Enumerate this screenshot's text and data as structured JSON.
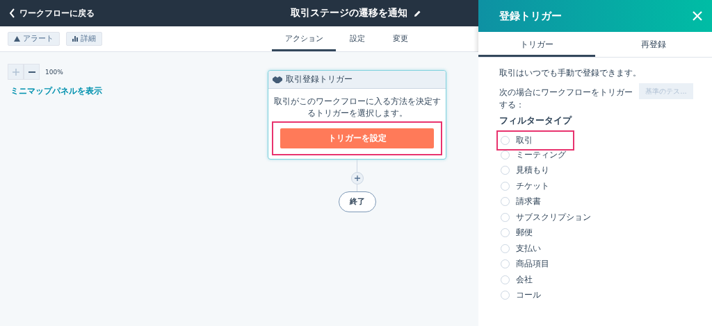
{
  "topbar": {
    "back_link": "ワークフローに戻る",
    "title": "取引ステージの遷移を通知"
  },
  "toolbar": {
    "buttons": [
      {
        "label": "アラート",
        "kind": "alert"
      },
      {
        "label": "詳細",
        "kind": "chart"
      }
    ]
  },
  "tabs": [
    {
      "label": "アクション",
      "selected": true
    },
    {
      "label": "設定",
      "selected": false
    },
    {
      "label": "変更",
      "selected": false
    }
  ],
  "zoom": {
    "reading": "100%",
    "minimap_link": "ミニマップパネルを表示"
  },
  "trigger_card": {
    "title": "取引登録トリガー",
    "description": "取引がこのワークフローに入る方法を決定するトリガーを選択します。",
    "button": "トリガーを設定",
    "highlighted": true
  },
  "end_node": "終了",
  "panel": {
    "title": "登録トリガー",
    "tabs": [
      {
        "label": "トリガー",
        "selected": true
      },
      {
        "label": "再登録",
        "selected": false
      }
    ],
    "note": "取引はいつでも手動で登録できます。",
    "trigger_text": "次の場合にワークフローをトリガーする：",
    "test_button": {
      "label": "基準のテス...",
      "disabled": true
    },
    "filter_heading": "フィルタータイプ",
    "options": [
      {
        "label": "取引",
        "selected": false,
        "highlighted": true
      },
      {
        "label": "ミーティング",
        "selected": false,
        "highlighted": false
      },
      {
        "label": "見積もり",
        "selected": false,
        "highlighted": false
      },
      {
        "label": "チケット",
        "selected": false,
        "highlighted": false
      },
      {
        "label": "請求書",
        "selected": false,
        "highlighted": false
      },
      {
        "label": "サブスクリプション",
        "selected": false,
        "highlighted": false
      },
      {
        "label": "郵便",
        "selected": false,
        "highlighted": false
      },
      {
        "label": "支払い",
        "selected": false,
        "highlighted": false
      },
      {
        "label": "商品項目",
        "selected": false,
        "highlighted": false
      },
      {
        "label": "会社",
        "selected": false,
        "highlighted": false
      },
      {
        "label": "コール",
        "selected": false,
        "highlighted": false
      }
    ]
  }
}
